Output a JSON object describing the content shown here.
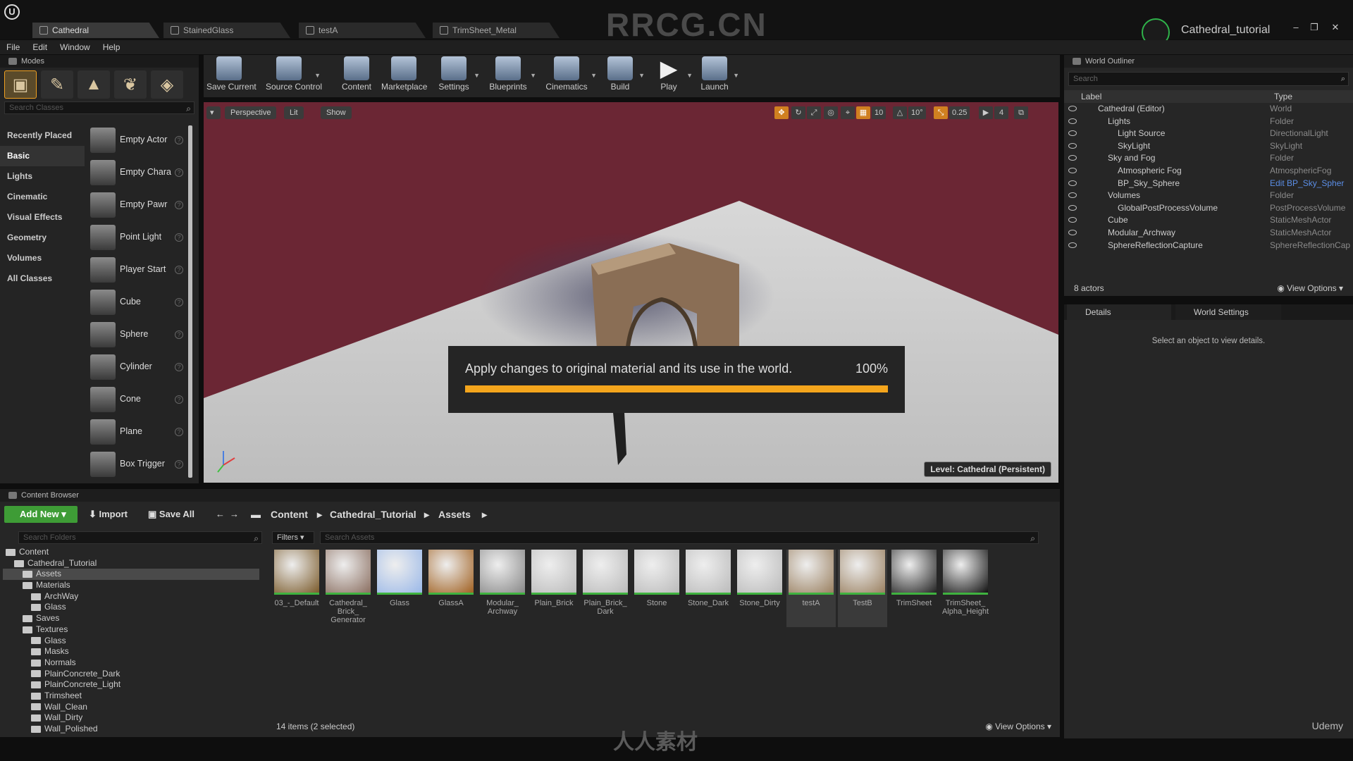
{
  "window": {
    "tabs": [
      "Cathedral",
      "StainedGlass",
      "testA",
      "TrimSheet_Metal"
    ],
    "watermark_title": "RRCG.CN",
    "project_name": "Cathedral_tutorial",
    "controls": [
      "–",
      "❐",
      "✕"
    ]
  },
  "menu": [
    "File",
    "Edit",
    "Window",
    "Help"
  ],
  "modes": {
    "title": "Modes",
    "search_placeholder": "Search Classes",
    "categories": [
      "Recently Placed",
      "Basic",
      "Lights",
      "Cinematic",
      "Visual Effects",
      "Geometry",
      "Volumes",
      "All Classes"
    ],
    "items": [
      "Empty Actor",
      "Empty Chara",
      "Empty Pawr",
      "Point Light",
      "Player Start",
      "Cube",
      "Sphere",
      "Cylinder",
      "Cone",
      "Plane",
      "Box Trigger"
    ]
  },
  "toolbar": {
    "buttons": [
      "Save Current",
      "Source Control",
      "Content",
      "Marketplace",
      "Settings",
      "Blueprints",
      "Cinematics",
      "Build",
      "Play",
      "Launch"
    ]
  },
  "viewport": {
    "buttons": [
      "Perspective",
      "Lit",
      "Show"
    ],
    "grid_snap": "10",
    "rot_snap": "10°",
    "scale_snap": "0.25",
    "cam_speed": "4",
    "level_label": "Level:  Cathedral (Persistent)",
    "progress": {
      "message": "Apply changes to original material and its use in the world.",
      "percent_text": "100%",
      "percent": 100,
      "color": "#f4a51c"
    }
  },
  "outliner": {
    "title": "World Outliner",
    "search_placeholder": "Search",
    "col_label": "Label",
    "col_type": "Type",
    "rows": [
      {
        "name": "Cathedral (Editor)",
        "type": "World",
        "indent": 0
      },
      {
        "name": "Lights",
        "type": "Folder",
        "indent": 1
      },
      {
        "name": "Light Source",
        "type": "DirectionalLight",
        "indent": 2
      },
      {
        "name": "SkyLight",
        "type": "SkyLight",
        "indent": 2
      },
      {
        "name": "Sky and Fog",
        "type": "Folder",
        "indent": 1
      },
      {
        "name": "Atmospheric Fog",
        "type": "AtmosphericFog",
        "indent": 2
      },
      {
        "name": "BP_Sky_Sphere",
        "type": "Edit BP_Sky_Spher",
        "indent": 2,
        "link": true
      },
      {
        "name": "Volumes",
        "type": "Folder",
        "indent": 1
      },
      {
        "name": "GlobalPostProcessVolume",
        "type": "PostProcessVolume",
        "indent": 2
      },
      {
        "name": "Cube",
        "type": "StaticMeshActor",
        "indent": 1
      },
      {
        "name": "Modular_Archway",
        "type": "StaticMeshActor",
        "indent": 1
      },
      {
        "name": "SphereReflectionCapture",
        "type": "SphereReflectionCap",
        "indent": 1
      }
    ],
    "count": "8 actors",
    "view_options": "View Options"
  },
  "details": {
    "tab1": "Details",
    "tab2": "World Settings",
    "empty_msg": "Select an object to view details."
  },
  "content_browser": {
    "title": "Content Browser",
    "add_new": "Add New",
    "import": "Import",
    "save_all": "Save All",
    "breadcrumb": [
      "Content",
      "Cathedral_Tutorial",
      "Assets"
    ],
    "folder_search": "Search Folders",
    "filters": "Filters",
    "asset_search": "Search Assets",
    "folders": [
      {
        "name": "Content",
        "indent": 0
      },
      {
        "name": "Cathedral_Tutorial",
        "indent": 1
      },
      {
        "name": "Assets",
        "indent": 2,
        "selected": true
      },
      {
        "name": "Materials",
        "indent": 2
      },
      {
        "name": "ArchWay",
        "indent": 3
      },
      {
        "name": "Glass",
        "indent": 3
      },
      {
        "name": "Saves",
        "indent": 2
      },
      {
        "name": "Textures",
        "indent": 2
      },
      {
        "name": "Glass",
        "indent": 3
      },
      {
        "name": "Masks",
        "indent": 3
      },
      {
        "name": "Normals",
        "indent": 3
      },
      {
        "name": "PlainConcrete_Dark",
        "indent": 3
      },
      {
        "name": "PlainConcrete_Light",
        "indent": 3
      },
      {
        "name": "Trimsheet",
        "indent": 3
      },
      {
        "name": "Wall_Clean",
        "indent": 3
      },
      {
        "name": "Wall_Dirty",
        "indent": 3
      },
      {
        "name": "Wall_Polished",
        "indent": 3
      }
    ],
    "assets": [
      "03_-_Default",
      "Cathedral_ Brick_ Generator",
      "Glass",
      "GlassA",
      "Modular_ Archway",
      "Plain_Brick",
      "Plain_Brick_ Dark",
      "Stone",
      "Stone_Dark",
      "Stone_Dirty",
      "testA",
      "TestB",
      "TrimSheet",
      "TrimSheet_ Alpha_Height"
    ],
    "status": "14 items (2 selected)",
    "view_options": "View Options"
  },
  "branding": {
    "udemy": "Udemy",
    "bottom_mark": "人人素材"
  }
}
